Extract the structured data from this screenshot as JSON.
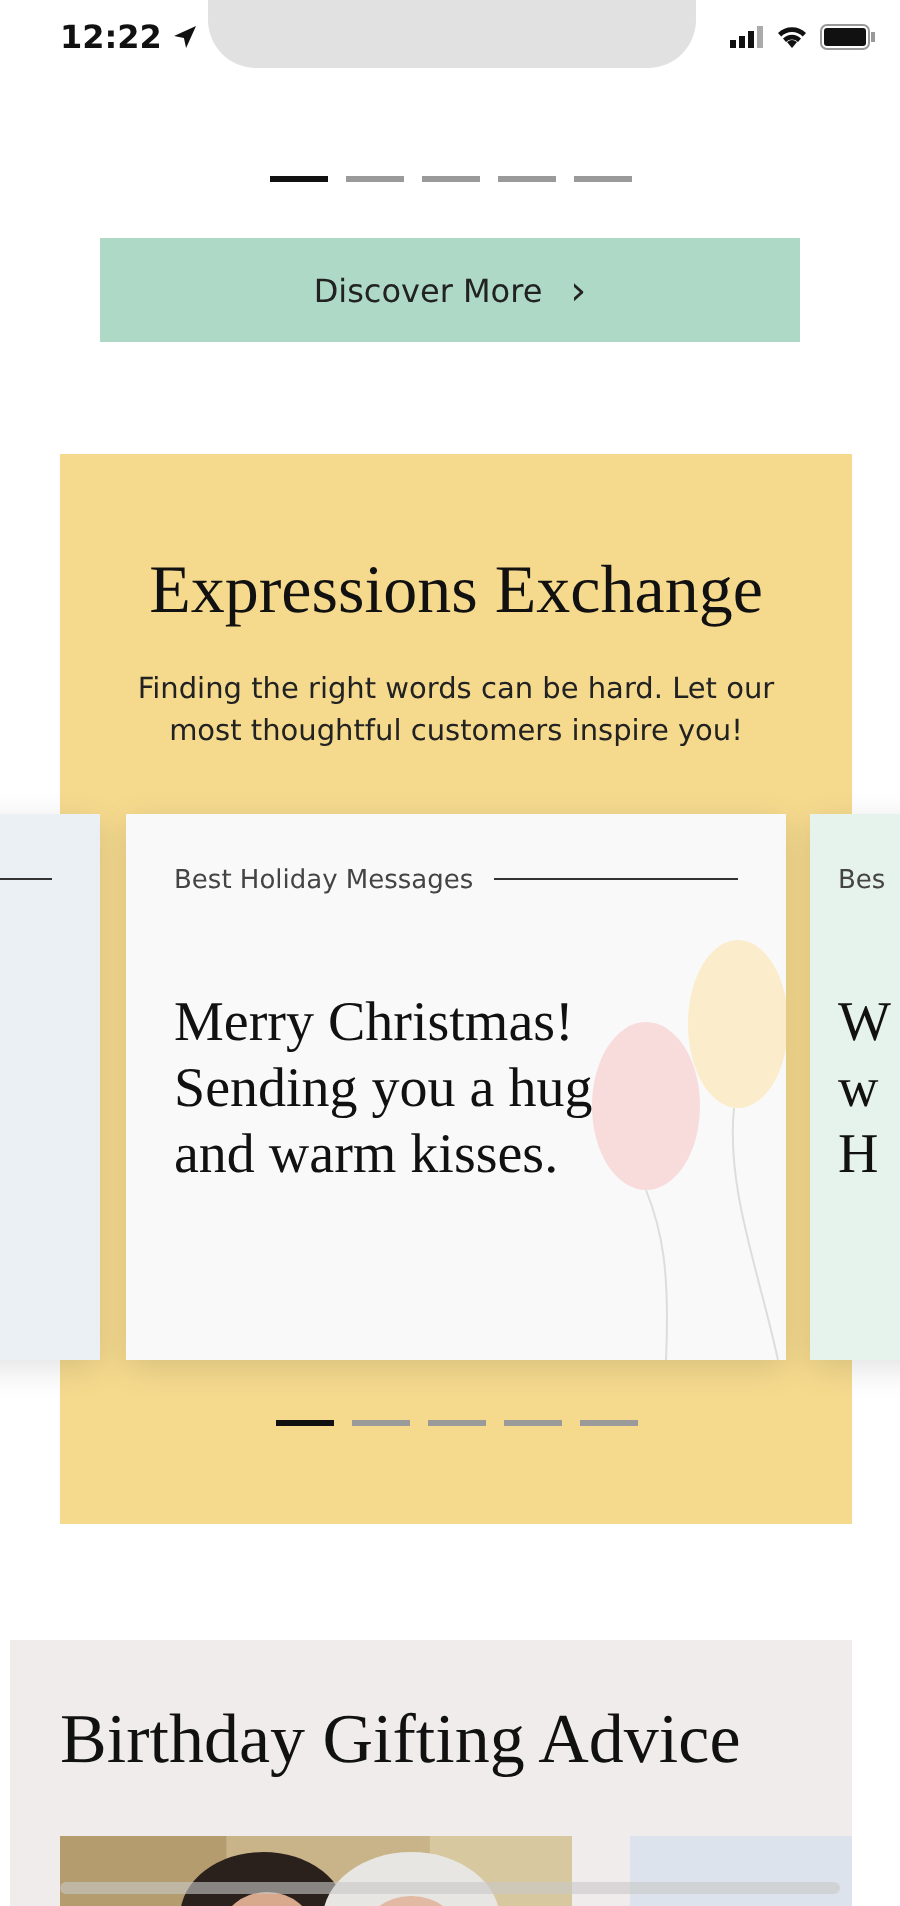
{
  "status_bar": {
    "time": "12:22"
  },
  "top_carousel": {
    "dots": [
      {
        "selected": true
      },
      {
        "selected": false
      },
      {
        "selected": false
      },
      {
        "selected": false
      },
      {
        "selected": false
      }
    ]
  },
  "discover_button": {
    "label": "Discover More",
    "chevron": "›"
  },
  "expressions": {
    "title": "Expressions Exchange",
    "subtitle": "Finding the right words can be hard. Let our most thoughtful customers inspire you!",
    "cards": [
      {
        "kind": "peek_left"
      },
      {
        "kind": "main",
        "label": "Best Holiday Messages",
        "lines": [
          "Merry Christmas!",
          "Sending you a hug",
          "and warm kisses."
        ]
      },
      {
        "kind": "peek_right",
        "label": "Bes",
        "lines": [
          "W",
          "w",
          "H"
        ]
      }
    ],
    "dots": [
      {
        "selected": true
      },
      {
        "selected": false
      },
      {
        "selected": false
      },
      {
        "selected": false
      },
      {
        "selected": false
      }
    ]
  },
  "birthday": {
    "title": "Birthday Gifting Advice",
    "items": [
      {
        "kind": "picture"
      },
      {
        "kind": "blank"
      }
    ]
  }
}
